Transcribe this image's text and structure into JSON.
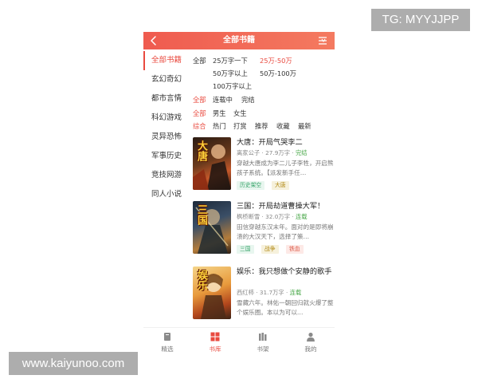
{
  "watermarks": {
    "top_right": "TG: MYYJJPP",
    "bottom_left": "www.kaiyunoo.com"
  },
  "header": {
    "title": "全部书籍"
  },
  "sidebar": {
    "items": [
      {
        "label": "全部书籍"
      },
      {
        "label": "玄幻奇幻"
      },
      {
        "label": "都市言情"
      },
      {
        "label": "科幻游戏"
      },
      {
        "label": "灵异恐怖"
      },
      {
        "label": "军事历史"
      },
      {
        "label": "竞技网游"
      },
      {
        "label": "同人小说"
      }
    ]
  },
  "filters": {
    "words": {
      "all": "全部",
      "options": [
        "25万字一下",
        "25万-50万",
        "50万字以上",
        "50万-100万",
        "100万字以上"
      ]
    },
    "status": {
      "all": "全部",
      "options": [
        "连载中",
        "完结"
      ]
    },
    "gender": {
      "all": "全部",
      "options": [
        "男生",
        "女生"
      ]
    },
    "sort": {
      "all": "综合",
      "options": [
        "热门",
        "打赏",
        "推荐",
        "收藏",
        "最新"
      ]
    }
  },
  "books": [
    {
      "title": "大唐：开局气哭李二",
      "author": "离家公子",
      "words": "27.9万字",
      "status": "完结",
      "desc": "穿越大唐成为李二儿子李牲，开启熊孩子系统。【派发新手任…",
      "tags": [
        "历史架空",
        "大唐"
      ],
      "cover_text": "大唐"
    },
    {
      "title": "三国：开局劫道曹操大军！",
      "author": "枫桥断雪",
      "words": "32.0万字",
      "status": "连载",
      "desc": "田信穿越东汉末年。面对的是即将崩溃的大汉天下，选择了策…",
      "tags": [
        "三国",
        "战争",
        "铁血"
      ],
      "cover_text": "三国"
    },
    {
      "title": "娱乐：我只想做个安静的歌手",
      "author": "西红柿",
      "words": "31.7万字",
      "status": "连载",
      "desc": "雪藏六年。林佑一朝回归就火爆了整个娱乐圈。本以为可以…",
      "tags": [],
      "cover_text": "娱乐"
    }
  ],
  "tabbar": {
    "items": [
      {
        "label": "精选",
        "icon": "book-icon"
      },
      {
        "label": "书库",
        "icon": "grid-icon"
      },
      {
        "label": "书架",
        "icon": "shelf-icon"
      },
      {
        "label": "我的",
        "icon": "user-icon"
      }
    ]
  },
  "colors": {
    "accent": "#e94a3f",
    "header_start": "#ef5b4f",
    "header_end": "#f47a60",
    "status_green": "#4aa84a"
  }
}
